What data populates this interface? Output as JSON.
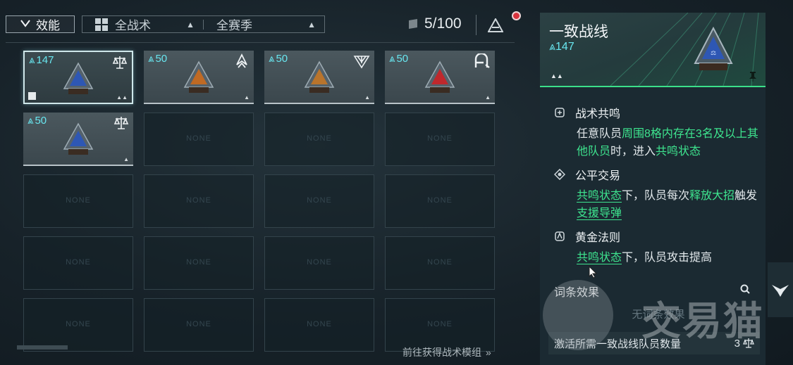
{
  "topbar": {
    "effect_label": "效能",
    "tactic_filter": "全战术",
    "season_filter": "全赛季",
    "count": "5/100"
  },
  "slots": [
    {
      "cost": "147",
      "filled": true,
      "selected": true,
      "emblem": "scales-icon",
      "color": "#2e57b4"
    },
    {
      "cost": "50",
      "filled": true,
      "selected": false,
      "emblem": "hawk-icon",
      "color": "#c06a24"
    },
    {
      "cost": "50",
      "filled": true,
      "selected": false,
      "emblem": "diamond-emblem-icon",
      "color": "#b9742c"
    },
    {
      "cost": "50",
      "filled": true,
      "selected": false,
      "emblem": "a-logo-icon",
      "color": "#c0282c"
    },
    {
      "cost": "50",
      "filled": true,
      "selected": false,
      "emblem": "scales-icon",
      "color": "#2e57b4"
    },
    {
      "none": "NONE"
    },
    {
      "none": "NONE"
    },
    {
      "none": "NONE"
    },
    {
      "none": "NONE"
    },
    {
      "none": "NONE"
    },
    {
      "none": "NONE"
    },
    {
      "none": "NONE"
    },
    {
      "none": "NONE"
    },
    {
      "none": "NONE"
    },
    {
      "none": "NONE"
    },
    {
      "none": "NONE"
    },
    {
      "none": "NONE"
    },
    {
      "none": "NONE"
    },
    {
      "none": "NONE"
    },
    {
      "none": "NONE"
    }
  ],
  "footer": {
    "goto_label": "前往获得战术模组"
  },
  "panel": {
    "title": "一致战线",
    "cost": "147",
    "effects": [
      {
        "name": "战术共鸣"
      },
      {
        "name": "公平交易"
      },
      {
        "name": "黄金法则"
      }
    ],
    "e1": {
      "a": "任意队员",
      "b": "周围8格内存在3名及以上其他队员",
      "c": "时，进入",
      "d": "共鸣状态"
    },
    "e2": {
      "a": "共鸣状态",
      "b": "下，队员每次",
      "c": "释放大招",
      "d": "触发",
      "e": "支援导弹"
    },
    "e3": {
      "a": "共鸣状态",
      "b": "下，队员攻击提高"
    },
    "keywords_title": "词条效果",
    "keywords_empty": "无词条效果",
    "requirement": "激活所需一致战线队员数量",
    "requirement_count": "3"
  },
  "watermark": "交易猫"
}
